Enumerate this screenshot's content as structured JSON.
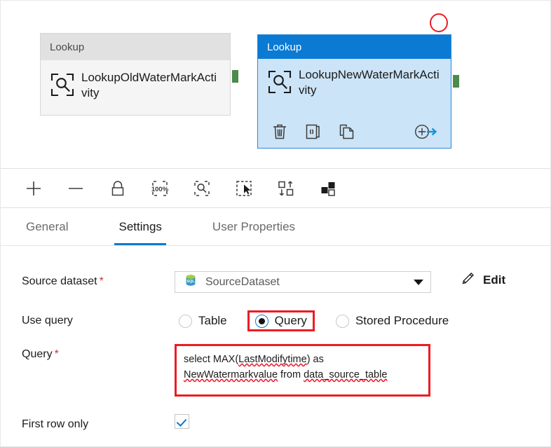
{
  "canvas": {
    "nodes": [
      {
        "type_label": "Lookup",
        "name": "LookupOldWaterMarkActivity",
        "icon": "lookup-magnifier-icon",
        "selected": false
      },
      {
        "type_label": "Lookup",
        "name": "LookupNewWaterMarkActivity",
        "icon": "lookup-magnifier-icon",
        "selected": true,
        "actions": [
          {
            "name": "delete-activity-icon",
            "label": "Delete"
          },
          {
            "name": "view-code-icon",
            "label": "Code"
          },
          {
            "name": "duplicate-activity-icon",
            "label": "Clone"
          },
          {
            "name": "add-output-icon",
            "label": "Add output"
          }
        ]
      }
    ],
    "annotation": {
      "name": "red-circle-annotation",
      "shape": "circle",
      "color": "#ec1c24"
    },
    "connector_color": "#4b8b4b"
  },
  "toolbar": {
    "buttons": [
      {
        "name": "zoom-in-button",
        "icon": "plus-icon",
        "label": "Zoom in"
      },
      {
        "name": "zoom-out-button",
        "icon": "minus-icon",
        "label": "Zoom out"
      },
      {
        "name": "lock-canvas-button",
        "icon": "lock-icon",
        "label": "Lock"
      },
      {
        "name": "zoom-to-100-button",
        "icon": "zoom-100-percent-icon",
        "label": "100%"
      },
      {
        "name": "zoom-to-fit-button",
        "icon": "zoom-fit-icon",
        "label": "Zoom to fit"
      },
      {
        "name": "select-all-button",
        "icon": "marquee-select-icon",
        "label": "Select all"
      },
      {
        "name": "auto-align-button",
        "icon": "auto-align-icon",
        "label": "Auto align"
      },
      {
        "name": "layout-button",
        "icon": "layout-blocks-icon",
        "label": "Layout"
      }
    ],
    "zoom_level": "100%"
  },
  "tabs": [
    {
      "name": "tab-general",
      "label": "General",
      "active": false
    },
    {
      "name": "tab-settings",
      "label": "Settings",
      "active": true
    },
    {
      "name": "tab-user-properties",
      "label": "User Properties",
      "active": false
    }
  ],
  "settings": {
    "source_dataset": {
      "label": "Source dataset",
      "required_marker": "*",
      "value": "SourceDataset",
      "icon": "sql-database-icon",
      "edit_label": "Edit",
      "edit_icon": "pencil-icon"
    },
    "use_query": {
      "label": "Use query",
      "options": [
        {
          "name": "radio-table",
          "label": "Table",
          "checked": false,
          "highlighted": false
        },
        {
          "name": "radio-query",
          "label": "Query",
          "checked": true,
          "highlighted": true
        },
        {
          "name": "radio-stored-procedure",
          "label": "Stored Procedure",
          "checked": false,
          "highlighted": false
        }
      ]
    },
    "query": {
      "label": "Query",
      "required_marker": "*",
      "line1_prefix": "select MAX(",
      "line1_misspelled": "LastModifytime",
      "line1_suffix": ") as",
      "line2_misspelled_a": "NewWatermarkvalue",
      "line2_middle": " from ",
      "line2_misspelled_b": "data_source_table",
      "full_text": "select MAX(LastModifytime) as NewWatermarkvalue from data_source_table",
      "highlighted": true
    },
    "first_row_only": {
      "label": "First row only",
      "checked": true
    }
  },
  "colors": {
    "accent_blue": "#0b7ad3",
    "selected_node_fill": "#cce4f7",
    "annotation_red": "#ec1c24",
    "required_red": "#d13438",
    "connector_green": "#4b8b4b"
  }
}
